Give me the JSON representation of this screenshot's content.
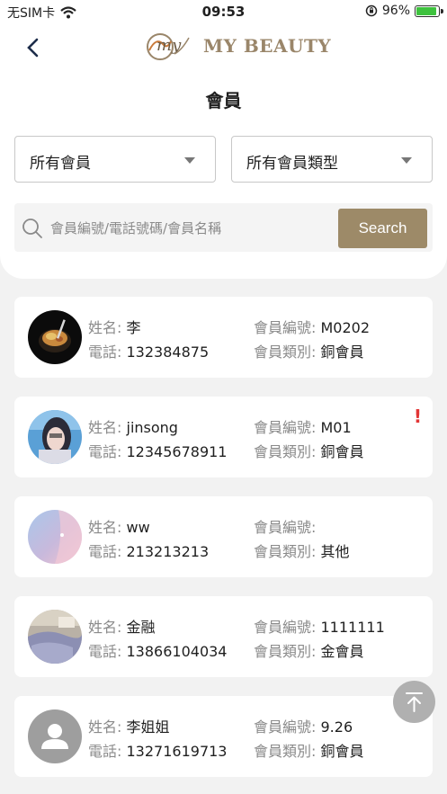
{
  "status_bar": {
    "carrier": "无SIM卡",
    "time": "09:53",
    "battery": "96%"
  },
  "header": {
    "brand": "MY BEAUTY",
    "title": "會員"
  },
  "filters": {
    "member_filter": "所有會員",
    "type_filter": "所有會員類型"
  },
  "search": {
    "placeholder": "會員編號/電話號碼/會員名稱",
    "button_label": "Search"
  },
  "labels": {
    "name": "姓名:",
    "phone": "電話:",
    "member_no": "會員編號:",
    "member_type": "會員類別:"
  },
  "members": [
    {
      "name": "李",
      "phone": "132384875",
      "member_no": "M0202",
      "type": "銅會員",
      "alert": ""
    },
    {
      "name": "jinsong",
      "phone": "12345678911",
      "member_no": "M01",
      "type": "銅會員",
      "alert": "!"
    },
    {
      "name": "ww",
      "phone": "213213213",
      "member_no": "",
      "type": "其他",
      "alert": ""
    },
    {
      "name": "金融",
      "phone": "13866104034",
      "member_no": "1111111",
      "type": "金會員",
      "alert": ""
    },
    {
      "name": "李姐姐",
      "phone": "13271619713",
      "member_no": "9.26",
      "type": "銅會員",
      "alert": ""
    }
  ],
  "colors": {
    "accent": "#9d8a68",
    "alert": "#e23535"
  }
}
